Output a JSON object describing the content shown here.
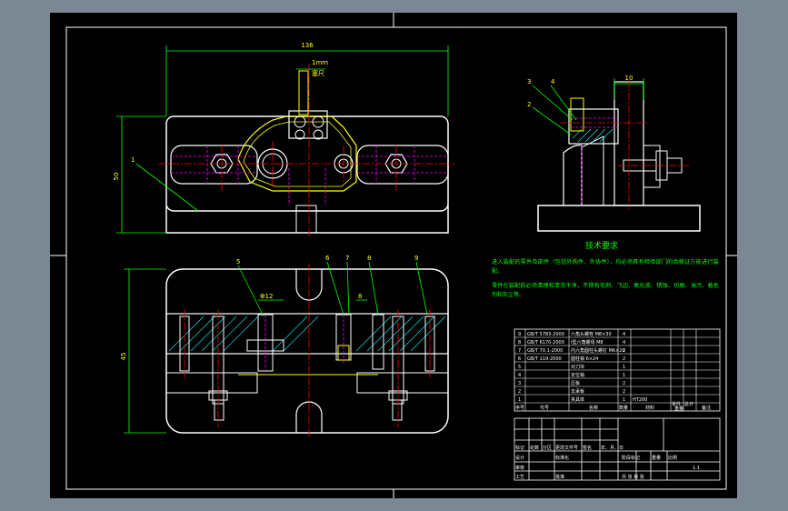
{
  "colors": {
    "background": "#7c8794",
    "sheet": "#000000",
    "outline": "#ffffff",
    "dimension": "#00ff00",
    "centerline": "#ff0000",
    "hidden": "#ff00ff",
    "hatch": "#00ffff",
    "text": "#ffff00",
    "cross_section": "#00ffff"
  },
  "drawing": {
    "dims": {
      "overall_width": "136",
      "height_left": "50",
      "height_lower": "45",
      "side_width": "10",
      "top_note_value": "1mm",
      "top_note_label": "塞尺",
      "lower_dia": "Φ12",
      "lower_small": "8"
    },
    "balloons": {
      "b1": "1",
      "b2": "2",
      "b3": "3",
      "b4": "4",
      "b5": "5",
      "b6": "6",
      "b7": "7",
      "b8": "8",
      "b9": "9"
    }
  },
  "notes": {
    "title": "技术要求",
    "line1": "进入装配的零件及部件（包括外购件、外协件），均必须具有检验部门的合格证方能进行装",
    "line2": "配。",
    "line3": "零件在装配前必须清理和清洗干净，不得有毛刺、飞边、氧化皮、锈蚀、切屑、油污、着色",
    "line4": "剂和灰尘等。"
  },
  "bom": {
    "rows": [
      {
        "no": "9",
        "code": "GB/T 5783-2000",
        "name": "六角头螺栓 M8×30",
        "qty": "4",
        "material": "",
        "note": ""
      },
      {
        "no": "8",
        "code": "GB/T 6170-2000",
        "name": "I型六角螺母 M8",
        "qty": "4",
        "material": "",
        "note": ""
      },
      {
        "no": "7",
        "code": "GB/T 70.1-2000",
        "name": "内六角圆柱头螺钉 M6×20",
        "qty": "2",
        "material": "",
        "note": ""
      },
      {
        "no": "6",
        "code": "GB/T 119-2000",
        "name": "圆柱销 6×24",
        "qty": "2",
        "material": "",
        "note": ""
      },
      {
        "no": "5",
        "code": "",
        "name": "对刀块",
        "qty": "1",
        "material": "",
        "note": ""
      },
      {
        "no": "4",
        "code": "",
        "name": "定位销",
        "qty": "1",
        "material": "",
        "note": ""
      },
      {
        "no": "3",
        "code": "",
        "name": "压板",
        "qty": "2",
        "material": "",
        "note": ""
      },
      {
        "no": "2",
        "code": "",
        "name": "支承板",
        "qty": "2",
        "material": "",
        "note": ""
      },
      {
        "no": "1",
        "code": "",
        "name": "夹具体",
        "qty": "1",
        "material": "HT200",
        "note": ""
      }
    ],
    "header": {
      "no": "序号",
      "code": "代号",
      "name": "名称",
      "qty": "数量",
      "material": "材料",
      "single": "单件",
      "total": "总计",
      "weight": "重量",
      "note": "备注"
    }
  },
  "title_block": {
    "mark": "标记",
    "count": "处数",
    "zone": "分区",
    "change_doc": "更改文件号",
    "sign": "签名",
    "date": "年、月、日",
    "design": "设计",
    "standardize": "标准化",
    "review": "审核",
    "process": "工艺",
    "approve": "批准",
    "stage_mark": "阶段标记",
    "weight": "重量",
    "scale": "比例",
    "scale_value": "1:1",
    "sheets": "共 张  第 张"
  }
}
